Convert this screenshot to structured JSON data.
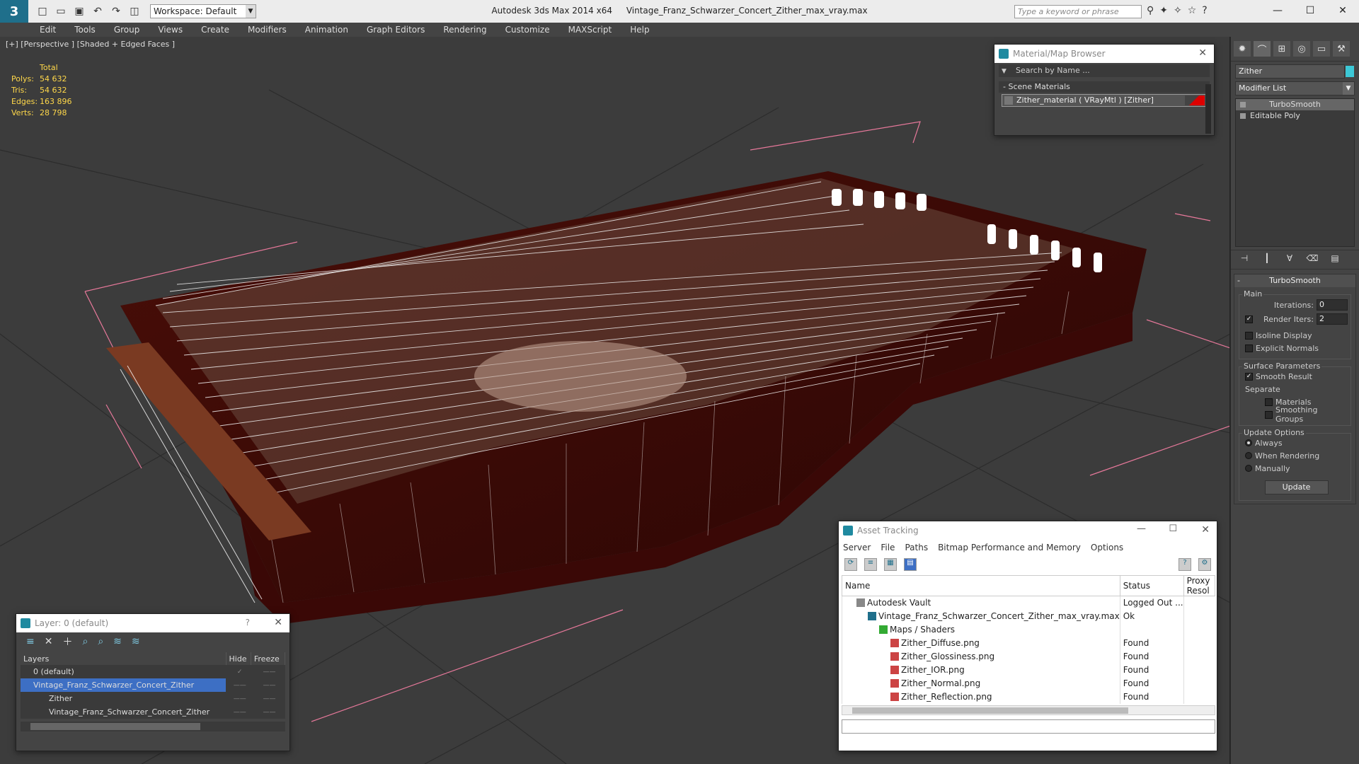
{
  "app": {
    "name": "Autodesk 3ds Max  2014 x64",
    "file": "Vintage_Franz_Schwarzer_Concert_Zither_max_vray.max",
    "workspace": "Workspace: Default",
    "search_placeholder": "Type a keyword or phrase"
  },
  "menu": [
    "Edit",
    "Tools",
    "Group",
    "Views",
    "Create",
    "Modifiers",
    "Animation",
    "Graph Editors",
    "Rendering",
    "Customize",
    "MAXScript",
    "Help"
  ],
  "viewport": {
    "label": "[+] [Perspective ] [Shaded + Edged Faces ]",
    "stats": {
      "header": "Total",
      "rows": [
        {
          "k": "Polys:",
          "v": "54 632"
        },
        {
          "k": "Tris:",
          "v": "54 632"
        },
        {
          "k": "Edges:",
          "v": "163 896"
        },
        {
          "k": "Verts:",
          "v": "28 798"
        }
      ]
    }
  },
  "command_panel": {
    "object_name": "Zither",
    "modifier_list": "Modifier List",
    "stack": [
      "TurboSmooth",
      "Editable Poly"
    ],
    "rollout_title": "TurboSmooth",
    "main_group": "Main",
    "iterations_label": "Iterations:",
    "iterations_value": "0",
    "render_iters_label": "Render Iters:",
    "render_iters_value": "2",
    "isoline": "Isoline Display",
    "explicit": "Explicit Normals",
    "surface_group": "Surface Parameters",
    "smooth_result": "Smooth Result",
    "separate": "Separate",
    "materials": "Materials",
    "smoothing_groups": "Smoothing Groups",
    "update_group": "Update Options",
    "always": "Always",
    "when_rendering": "When Rendering",
    "manually": "Manually",
    "update_btn": "Update"
  },
  "material_browser": {
    "title": "Material/Map Browser",
    "search": "Search by Name ...",
    "section": "- Scene Materials",
    "material": "Zither_material  ( VRayMtl )  [Zither]"
  },
  "layer_window": {
    "title": "Layer: 0 (default)",
    "help": "?",
    "columns": [
      "Layers",
      "Hide",
      "Freeze"
    ],
    "rows": [
      {
        "name": "0 (default)",
        "level": 1
      },
      {
        "name": "Vintage_Franz_Schwarzer_Concert_Zither",
        "level": 1,
        "selected": true
      },
      {
        "name": "Zither",
        "level": 2
      },
      {
        "name": "Vintage_Franz_Schwarzer_Concert_Zither",
        "level": 2
      }
    ]
  },
  "asset_tracking": {
    "title": "Asset Tracking",
    "menu": [
      "Server",
      "File",
      "Paths",
      "Bitmap Performance and Memory",
      "Options"
    ],
    "columns": [
      "Name",
      "Status",
      "Proxy Resol"
    ],
    "rows": [
      {
        "name": "Autodesk Vault",
        "status": "Logged Out ...",
        "indent": 20,
        "icon": "v"
      },
      {
        "name": "Vintage_Franz_Schwarzer_Concert_Zither_max_vray.max",
        "status": "Ok",
        "indent": 36,
        "icon": "f"
      },
      {
        "name": "Maps / Shaders",
        "status": "",
        "indent": 52,
        "icon": "m"
      },
      {
        "name": "Zither_Diffuse.png",
        "status": "Found",
        "indent": 68,
        "icon": "p"
      },
      {
        "name": "Zither_Glossiness.png",
        "status": "Found",
        "indent": 68,
        "icon": "p"
      },
      {
        "name": "Zither_IOR.png",
        "status": "Found",
        "indent": 68,
        "icon": "p"
      },
      {
        "name": "Zither_Normal.png",
        "status": "Found",
        "indent": 68,
        "icon": "p"
      },
      {
        "name": "Zither_Reflection.png",
        "status": "Found",
        "indent": 68,
        "icon": "p"
      }
    ]
  }
}
